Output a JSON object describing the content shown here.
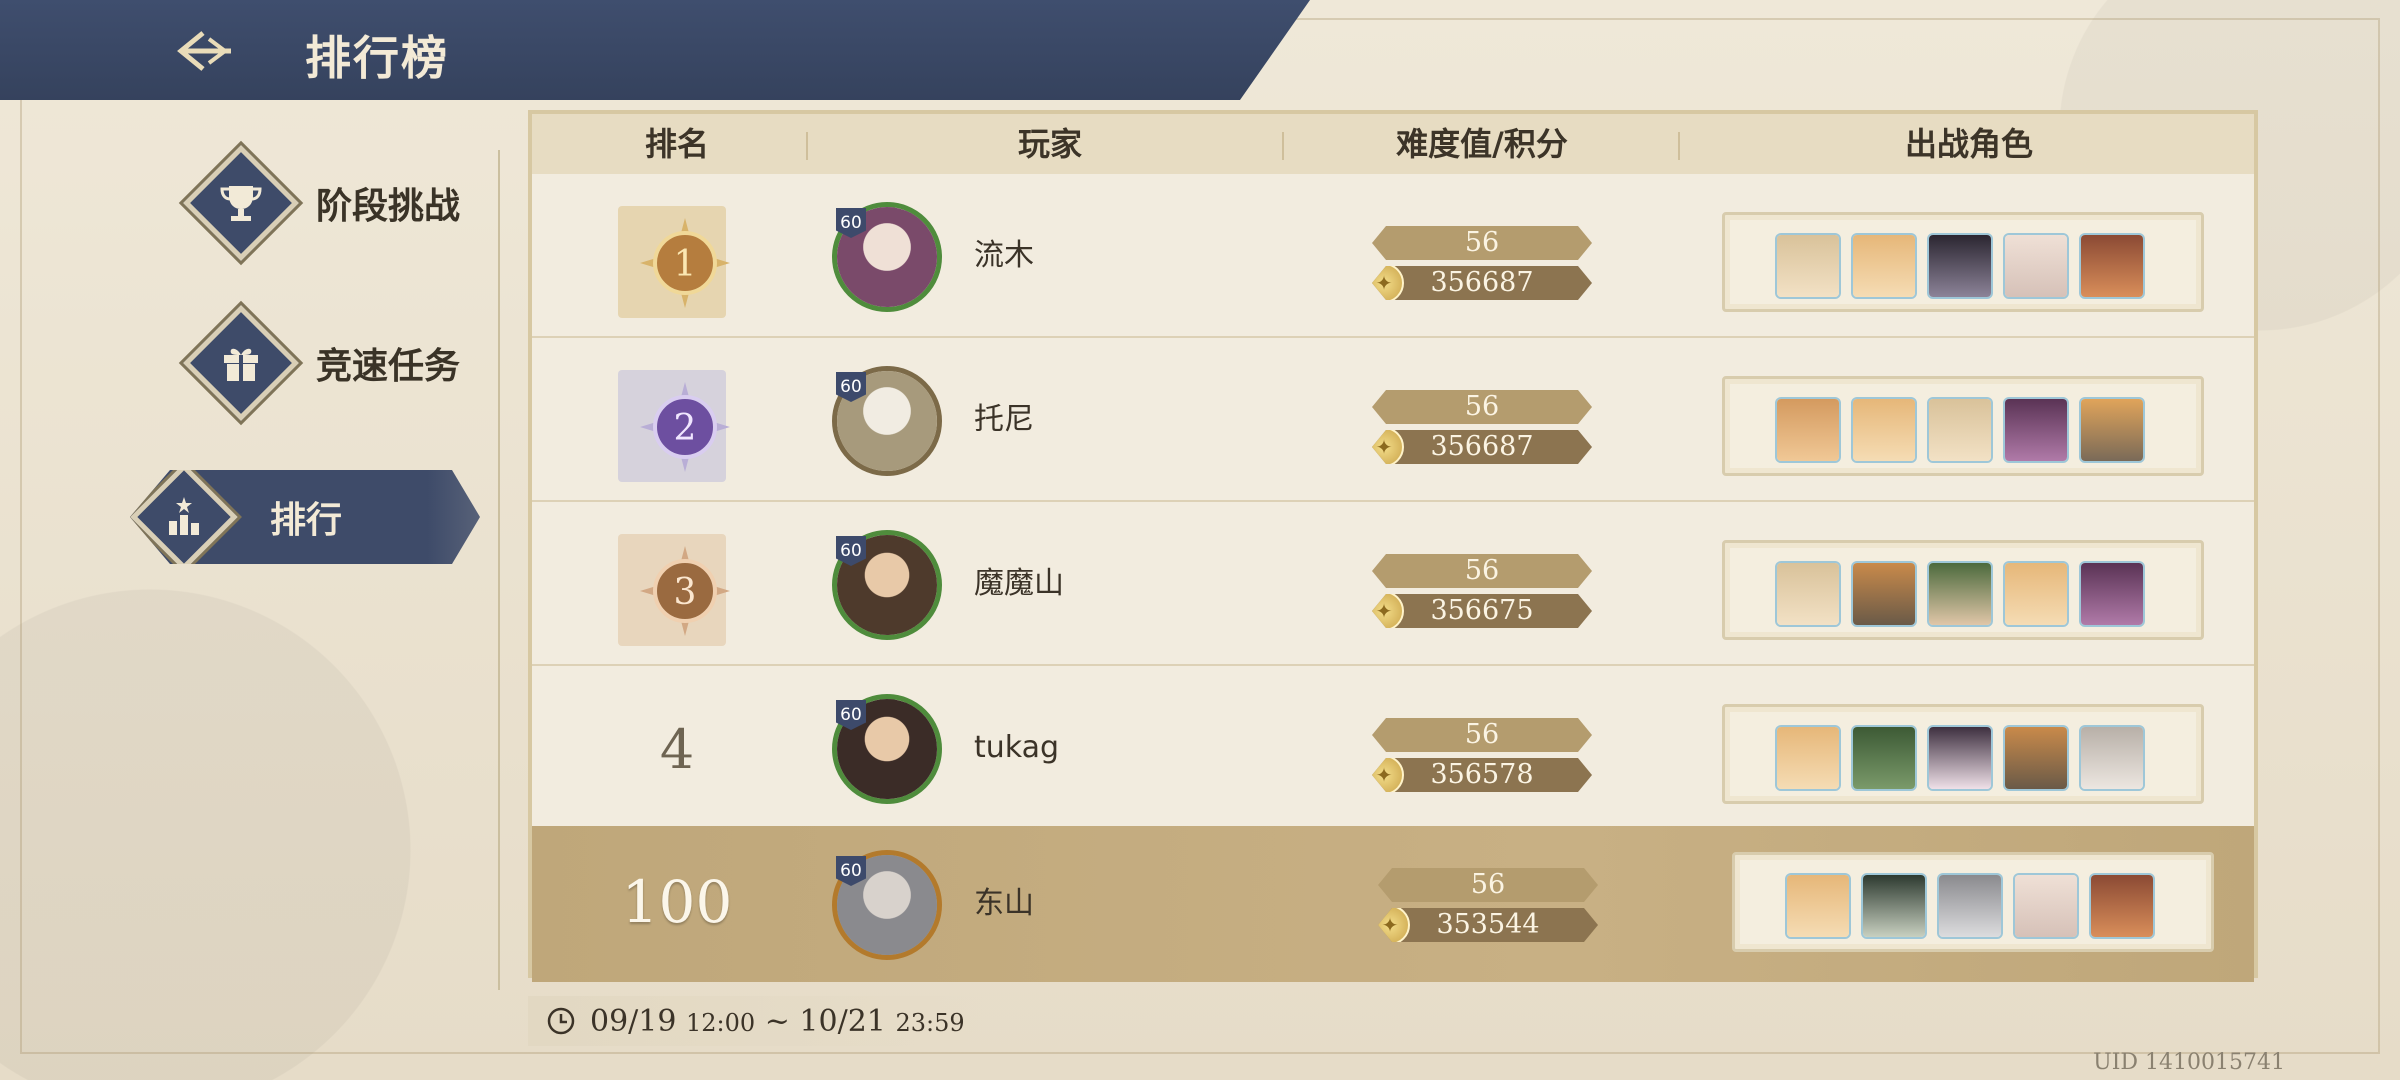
{
  "header": {
    "title": "排行榜"
  },
  "sidebar": {
    "items": [
      {
        "label": "阶段挑战",
        "icon": "trophy-icon"
      },
      {
        "label": "竞速任务",
        "icon": "gift-icon"
      },
      {
        "label": "排行",
        "icon": "bar-chart-icon",
        "active": true
      }
    ]
  },
  "table": {
    "headers": {
      "rank": "排名",
      "player": "玩家",
      "score": "难度值/积分",
      "team": "出战角色"
    },
    "rows": [
      {
        "rank": "1",
        "level": "60",
        "name": "流木",
        "difficulty": "56",
        "points": "356687",
        "avatar_color": "#7a4a6a",
        "team": [
          "#d9c29a",
          "#e6b779",
          "#2b2631",
          "#efe0d6",
          "#8b4a34"
        ]
      },
      {
        "rank": "2",
        "level": "60",
        "name": "托尼",
        "difficulty": "56",
        "points": "356687",
        "avatar_color": "#a79a7c",
        "team": [
          "#d49a5f",
          "#e6b779",
          "#d9c29a",
          "#5a3355",
          "#e0a45a"
        ]
      },
      {
        "rank": "3",
        "level": "60",
        "name": "魔魔山",
        "difficulty": "56",
        "points": "356675",
        "avatar_color": "#4e3a2c",
        "team": [
          "#d9c29a",
          "#c98a4a",
          "#4c6a3d",
          "#e6b779",
          "#5a3355"
        ]
      },
      {
        "rank": "4",
        "level": "60",
        "name": "tukag",
        "difficulty": "56",
        "points": "356578",
        "avatar_color": "#3b2c27",
        "team": [
          "#e6b779",
          "#3d5a35",
          "#3e3040",
          "#c98a4a",
          "#b8b0a8"
        ]
      },
      {
        "rank": "100",
        "level": "60",
        "name": "东山",
        "difficulty": "56",
        "points": "353544",
        "avatar_color": "#8a8a8e",
        "team": [
          "#e6b779",
          "#2d3a30",
          "#8a8a8e",
          "#efe0d6",
          "#8b4a34"
        ],
        "self": true
      }
    ]
  },
  "time_range": {
    "start_date": "09/19",
    "start_time": "12:00",
    "separator": "~",
    "end_date": "10/21",
    "end_time": "23:59"
  },
  "uid": "UID 1410015741",
  "colors": {
    "header": "#3f4e6e",
    "gold": "#a68f64",
    "self_row": "#c8b084",
    "rank2": "#6d4fa0",
    "rank1": "#b88a3a",
    "rank3": "#9a6a40"
  }
}
